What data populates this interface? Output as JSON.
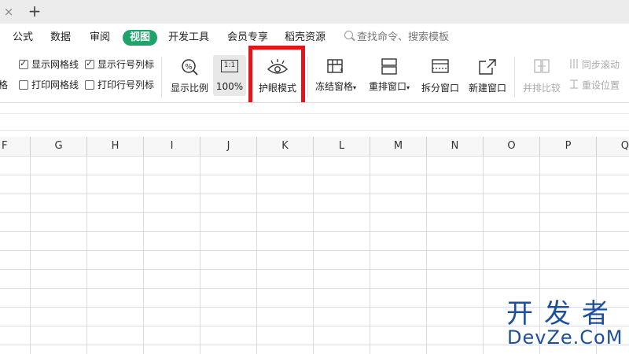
{
  "tabbar": {
    "close": "×",
    "add": "+"
  },
  "menu": {
    "items": [
      "公式",
      "数据",
      "审阅",
      "视图",
      "开发工具",
      "会员专享",
      "稻壳资源"
    ],
    "active": "视图",
    "search_placeholder": "查找命令、搜索模板"
  },
  "ribbon": {
    "left_partial": "格",
    "checkboxes": [
      {
        "label": "显示网格线",
        "checked": true
      },
      {
        "label": "显示行号列标",
        "checked": true
      },
      {
        "label": "打印网格线",
        "checked": false
      },
      {
        "label": "打印行号列标",
        "checked": false
      }
    ],
    "buttons": {
      "zoom_ratio": "显示比例",
      "zoom_100": "100%",
      "zoom_100_icon_text": "1:1",
      "eye_mode": "护眼模式",
      "freeze": "冻结窗格",
      "arrange": "重排窗口",
      "split": "拆分窗口",
      "new_window": "新建窗口",
      "compare": "并排比较",
      "sync_scroll": "同步滚动",
      "reset_pos": "重设位置"
    }
  },
  "sheet": {
    "columns": [
      "F",
      "G",
      "H",
      "I",
      "J",
      "K",
      "L",
      "M",
      "N",
      "O",
      "P",
      "Q"
    ]
  },
  "watermark": {
    "top": "开发者",
    "bottom": "DevZe.CoM"
  },
  "colors": {
    "active_tab": "#20a26b",
    "highlight": "#e2141c",
    "watermark": "#1e4f9c"
  }
}
